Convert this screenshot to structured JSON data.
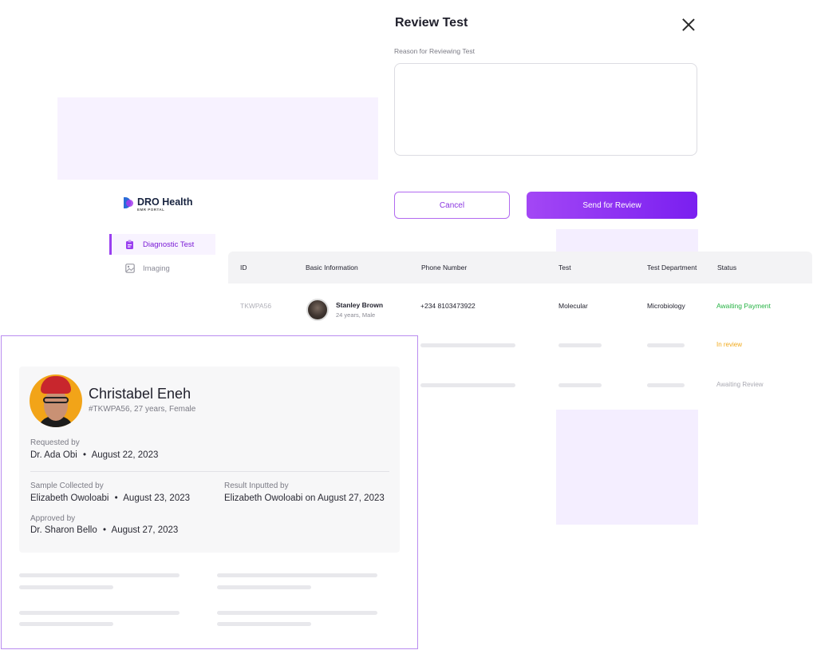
{
  "modal": {
    "title": "Review Test",
    "reason_label": "Reason for Reviewing Test",
    "reason_value": "",
    "cancel_label": "Cancel",
    "send_label": "Send for Review"
  },
  "sidebar": {
    "brand": "DRO Health",
    "brand_sub": "EMR PORTAL",
    "items": [
      {
        "label": "Diagnostic Test",
        "icon": "clipboard-icon",
        "active": true
      },
      {
        "label": "Imaging",
        "icon": "image-icon",
        "active": false
      }
    ]
  },
  "table": {
    "headers": [
      "ID",
      "Basic Information",
      "Phone Number",
      "Test",
      "Test Department",
      "Status"
    ],
    "rows": [
      {
        "id": "TKWPA56",
        "name": "Stanley Brown",
        "info": "24 years, Male",
        "phone": "+234 8103473922",
        "test": "Molecular",
        "department": "Microbiology",
        "status": "Awaiting Payment"
      },
      {
        "status": "In review"
      },
      {
        "status": "Awaiting Review"
      }
    ],
    "status_colors": {
      "Awaiting Payment": "#27b345",
      "In review": "#f0a91b",
      "Awaiting Review": "#a9a9b2"
    }
  },
  "patient_card": {
    "name": "Christabel Eneh",
    "meta": "#TKWPA56, 27 years, Female",
    "requested_by_label": "Requested by",
    "requested_by": "Dr. Ada Obi",
    "requested_date": "August 22, 2023",
    "sample_label": "Sample Collected by",
    "sample_by": "Elizabeth Owoloabi",
    "sample_date": "August 23, 2023",
    "result_label": "Result Inputted by",
    "result_text": "Elizabeth Owoloabi on August 27, 2023",
    "approved_label": "Approved by",
    "approved_by": "Dr. Sharon Bello",
    "approved_date": "August 27, 2023",
    "separator": "•"
  },
  "colors": {
    "accent": "#8a35e0",
    "accent_light": "#f7f2ff"
  }
}
